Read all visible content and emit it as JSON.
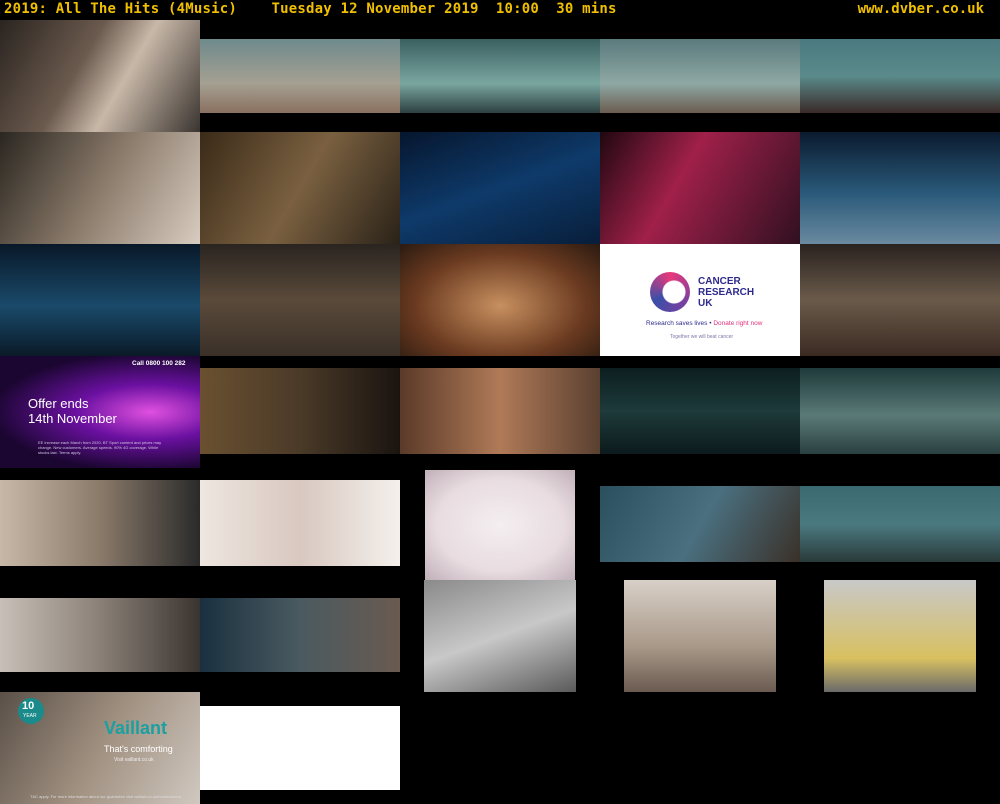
{
  "header": {
    "title": "2019: All The Hits (4Music)    Tuesday 12 November 2019  10:00  30 mins",
    "site": "www.dvber.co.uk"
  },
  "ads": {
    "offer": {
      "call": "Call 0800 100 282",
      "line1": "Offer ends",
      "line2": "14th November",
      "small": "EE increase each March from 2020. BT Sport content and prices may change. New customers. Average speeds. 90% 4G coverage. While stocks last. Terms apply."
    },
    "cancer": {
      "name_line1": "CANCER",
      "name_line2": "RESEARCH",
      "name_line3": "UK",
      "tag1": "Research saves lives • ",
      "tag2": "Donate right now",
      "tag3": "Together we will beat cancer"
    },
    "vaillant": {
      "badge_num": "10",
      "badge_txt": "YEAR",
      "brand": "Vaillant",
      "slogan": "That's comforting",
      "url": "Visit vaillant.co.uk",
      "small": "T&C apply. For more information about our guarantee visit vaillant.co.uk/homeowners"
    }
  },
  "thumbs": [
    {
      "name": "thumb-01",
      "bg": "linear-gradient(120deg,#2a2420,#6b5a4e 40%,#c8b8a8 60%,#3a3430)"
    },
    {
      "name": "thumb-02",
      "bg": "linear-gradient(180deg,#6e8a8c,#a5a092 60%,#8a7060)"
    },
    {
      "name": "thumb-03",
      "bg": "linear-gradient(180deg,#3a6060,#7aa6a0 60%,#2c4040)"
    },
    {
      "name": "thumb-04",
      "bg": "linear-gradient(180deg,#5a7a7c,#8ea8a4 60%,#6c5c50)"
    },
    {
      "name": "thumb-05",
      "bg": "linear-gradient(180deg,#4a7a80,#5a8a8a 50%,#3a2a28)"
    },
    {
      "name": "thumb-06",
      "bg": "linear-gradient(120deg,#2a2620,#8a7a6a 50%,#d8ccc0)"
    },
    {
      "name": "thumb-07",
      "bg": "linear-gradient(120deg,#3a2a18,#7a6040 50%,#2a2218)"
    },
    {
      "name": "thumb-08",
      "bg": "linear-gradient(160deg,#06162e,#0e3a6a 50%,#081e3a)"
    },
    {
      "name": "thumb-09",
      "bg": "linear-gradient(120deg,#200810,#a0204a 40%,#301020)"
    },
    {
      "name": "thumb-10",
      "bg": "linear-gradient(180deg,#0a1a2e,#2a5a7a 55%,#6a8aa0)"
    },
    {
      "name": "thumb-11",
      "bg": "linear-gradient(180deg,#081828,#1a4a6a 55%,#0a1a28)"
    },
    {
      "name": "thumb-12",
      "bg": "linear-gradient(180deg,#2a2420,#5a4a3a 50%,#3a3028)"
    },
    {
      "name": "thumb-13",
      "bg": "radial-gradient(ellipse at 50% 55%,#c89060,#6a3a20 60%,#2a1a10)"
    },
    {
      "name": "thumb-14",
      "bg": "#ffffff"
    },
    {
      "name": "thumb-15",
      "bg": "linear-gradient(180deg,#2a2220,#6a5a4a 50%,#3a2a22)"
    },
    {
      "name": "thumb-16",
      "bg": "radial-gradient(ellipse at 75% 50%,#e050e0,#6a10a0 35%,#1a0630 75%)"
    },
    {
      "name": "thumb-17",
      "bg": "linear-gradient(90deg,#6a5030,#4a3a28 50%,#1a1410)"
    },
    {
      "name": "thumb-18",
      "bg": "linear-gradient(90deg,#5a3a28,#b07a58 50%,#5a4030)"
    },
    {
      "name": "thumb-19",
      "bg": "linear-gradient(180deg,#0c1e20,#1e3a3a 50%,#0c1a1c)"
    },
    {
      "name": "thumb-20",
      "bg": "linear-gradient(180deg,#1e3a3a,#5a7a78 55%,#2a4040)"
    },
    {
      "name": "thumb-21",
      "bg": "linear-gradient(90deg,#c8b8a8,#8a7a6a 50%,#2a2a2a)"
    },
    {
      "name": "thumb-22",
      "bg": "linear-gradient(90deg,#eee6e0,#d8c8c0 50%,#f4f0ec)"
    },
    {
      "name": "thumb-23",
      "bg": "radial-gradient(ellipse at 50% 50%,#f4eef0,#e8dce0 60%,#c0b0b8)"
    },
    {
      "name": "thumb-24",
      "bg": "linear-gradient(120deg,#2a5060,#4a7080 50%,#3a3028)"
    },
    {
      "name": "thumb-25",
      "bg": "linear-gradient(180deg,#3a6a70,#4a7a80 50%,#2a3a3a)"
    },
    {
      "name": "thumb-26",
      "bg": "linear-gradient(90deg,#c8c0b8,#8a8078 50%,#3a3430)"
    },
    {
      "name": "thumb-27",
      "bg": "linear-gradient(90deg,#1a3040,#4a5a60 50%,#6a5a50)"
    },
    {
      "name": "thumb-28",
      "bg": "linear-gradient(160deg,#8a8a8a,#c8c8c8 50%,#5a5a5a)"
    },
    {
      "name": "thumb-29",
      "bg": "linear-gradient(180deg,#d8d0c8,#a89888 60%,#6a5a50)"
    },
    {
      "name": "thumb-30",
      "bg": "linear-gradient(180deg,#c8c8c8,#d8c060 70%,#6a6a6a)"
    },
    {
      "name": "thumb-31",
      "bg": "linear-gradient(120deg,#5a5048,#a09080 50%,#d0c8c0)"
    },
    {
      "name": "thumb-32",
      "bg": "#ffffff"
    }
  ]
}
